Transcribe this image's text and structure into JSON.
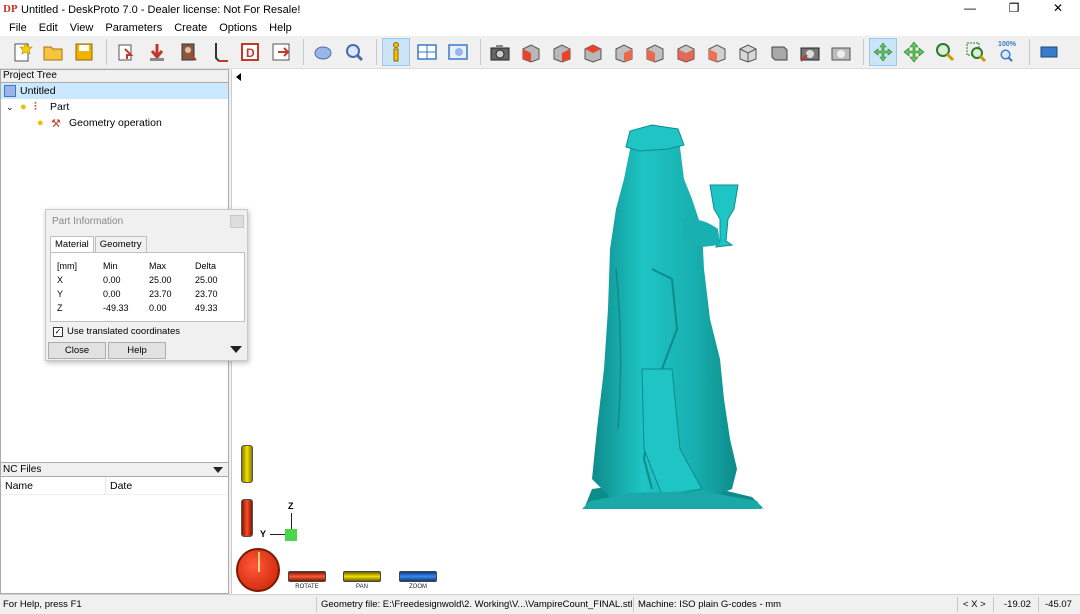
{
  "window": {
    "title": "Untitled - DeskProto 7.0 - Dealer license: Not For Resale!",
    "app_icon_text": "DP",
    "controls": {
      "minimize": "—",
      "restore": "❐",
      "close": "✕"
    }
  },
  "menu": [
    "File",
    "Edit",
    "View",
    "Parameters",
    "Create",
    "Options",
    "Help"
  ],
  "toolbar": {
    "zoom100_label": "100%",
    "icons": [
      "new-icon",
      "open-icon",
      "save-icon",
      "load-geometry-icon",
      "import-icon",
      "load-image-icon",
      "drill-icon",
      "2d-icon",
      "save-nc-icon",
      "view-object-icon",
      "zoom-view-icon",
      "info-icon",
      "layout-icon",
      "part-info-icon",
      "camera-icon",
      "front-view-icon",
      "back-view-icon",
      "left-view-icon",
      "right-view-icon",
      "top-view-icon",
      "bottom-view-icon",
      "iso-view-icon",
      "cube-view-icon",
      "render-icon",
      "snapshot-icon",
      "rotate-mode-icon",
      "pan-mode-icon",
      "zoom-mode-icon",
      "zoom-window-icon",
      "zoom-100-icon",
      "toolpath-icon"
    ]
  },
  "project_tree": {
    "header": "Project Tree",
    "nodes": [
      {
        "label": "Untitled",
        "level": 0
      },
      {
        "label": "Part",
        "level": 1
      },
      {
        "label": "Geometry operation",
        "level": 2
      }
    ]
  },
  "nc_files": {
    "header": "NC Files",
    "columns": [
      "Name",
      "Date"
    ]
  },
  "part_info": {
    "title": "Part Information",
    "tabs": [
      "Material",
      "Geometry"
    ],
    "table": {
      "header": [
        "[mm]",
        "Min",
        "Max",
        "Delta"
      ],
      "rows": [
        [
          "X",
          "0.00",
          "25.00",
          "25.00"
        ],
        [
          "Y",
          "0.00",
          "23.70",
          "23.70"
        ],
        [
          "Z",
          "-49.33",
          "0.00",
          "49.33"
        ]
      ]
    },
    "use_translated_label": "Use translated coordinates",
    "use_translated_checked": true,
    "close_label": "Close",
    "help_label": "Help"
  },
  "view_controls": {
    "rotate_label": "ROTATE",
    "pan_label": "PAN",
    "zoom_label": "ZOOM",
    "axis_z": "Z",
    "axis_y": "Y"
  },
  "colors": {
    "model": "#1fc4c4",
    "model_shadow": "#0e8b8b",
    "selection": "#cce8ff"
  },
  "statusbar": {
    "help": "For Help, press F1",
    "geometry_file": "Geometry file: E:\\Freedesignwold\\2. Working\\V...\\VampireCount_FINAL.stl",
    "machine": "Machine: ISO plain G-codes - mm",
    "axis_label": "< X >",
    "coord1": "-19.02",
    "coord2": "-45.07"
  }
}
